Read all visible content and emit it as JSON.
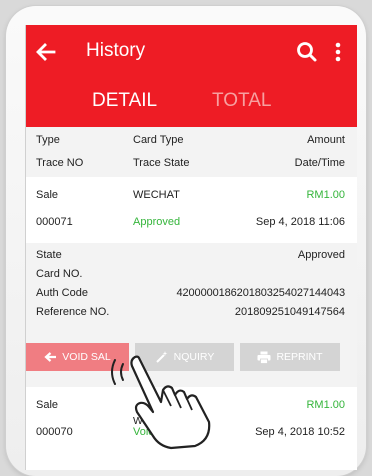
{
  "appbar": {
    "title": "History"
  },
  "tabs": [
    {
      "label": "DETAIL"
    },
    {
      "label": "TOTAL"
    }
  ],
  "columns": {
    "row1": [
      "Type",
      "Card Type",
      "Amount"
    ],
    "row2": [
      "Trace NO",
      "Trace State",
      "Date/Time"
    ]
  },
  "records": [
    {
      "type": "Sale",
      "card_type": "WECHAT",
      "amount": "RM1.00",
      "trace_no": "000071",
      "trace_state": "Approved",
      "datetime": "Sep 4, 2018 11:06"
    },
    {
      "type": "Sale",
      "card_type": "Wallet China",
      "amount": "RM1.00",
      "trace_no": "000070",
      "trace_state": "Voided",
      "datetime": "Sep 4, 2018 10:52"
    }
  ],
  "details": {
    "state_label": "State",
    "state_value": "Approved",
    "card_no_label": "Card NO.",
    "card_no_value": "",
    "auth_code_label": "Auth Code",
    "auth_code_value": "4200000186201803254027144043",
    "reference_label": "Reference NO.",
    "reference_value": "201809251049147564"
  },
  "actions": {
    "void_label": "VOID SAL",
    "enquiry_label": "NQUIRY",
    "reprint_label": "REPRINT"
  },
  "colors": {
    "brand_red": "#ee1c25",
    "approved_green": "#35b53b",
    "void_pink": "#f07d82",
    "disabled_gray": "#d4d4d4"
  },
  "icons": [
    "back-arrow-icon",
    "search-icon",
    "more-vert-icon",
    "back-arrow-small-icon",
    "magic-wand-icon",
    "printer-icon",
    "pointing-hand-icon"
  ]
}
